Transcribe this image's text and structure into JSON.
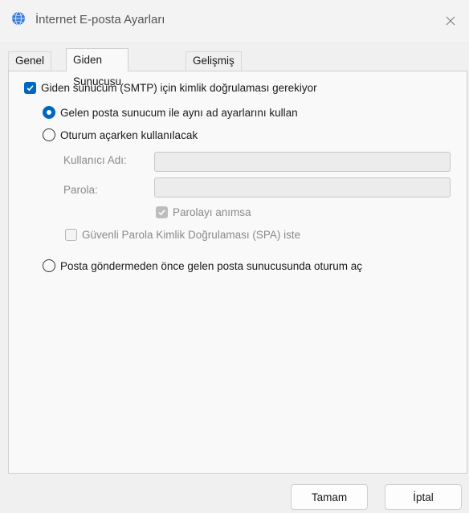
{
  "window": {
    "title": "İnternet E-posta Ayarları",
    "icon": "globe-mail-icon"
  },
  "tabs": [
    {
      "label": "Genel",
      "active": false
    },
    {
      "label": "Giden Sunucusu",
      "active": true
    },
    {
      "label": "Gelişmiş",
      "active": false
    }
  ],
  "outgoing": {
    "smtp_auth_label": "Giden sunucum (SMTP) için kimlik doğrulaması gerekiyor",
    "smtp_auth_checked": true,
    "same_settings_label": "Gelen posta sunucum ile aynı ad ayarlarını kullan",
    "same_settings_selected": true,
    "logon_using_label": "Oturum açarken kullanılacak",
    "logon_using_selected": false,
    "username_label": "Kullanıcı Adı:",
    "username_value": "",
    "password_label": "Parola:",
    "password_value": "",
    "remember_password_label": "Parolayı anımsa",
    "remember_password_checked": true,
    "spa_label": "Güvenli Parola Kimlik Doğrulaması (SPA) iste",
    "spa_checked": false,
    "logon_incoming_first_label": "Posta göndermeden önce gelen posta sunucusunda oturum aç",
    "logon_incoming_first_selected": false
  },
  "buttons": {
    "ok_label": "Tamam",
    "cancel_label": "İptal"
  },
  "colors": {
    "accent": "#0067c0",
    "disabled_text": "#8a8a8a"
  }
}
